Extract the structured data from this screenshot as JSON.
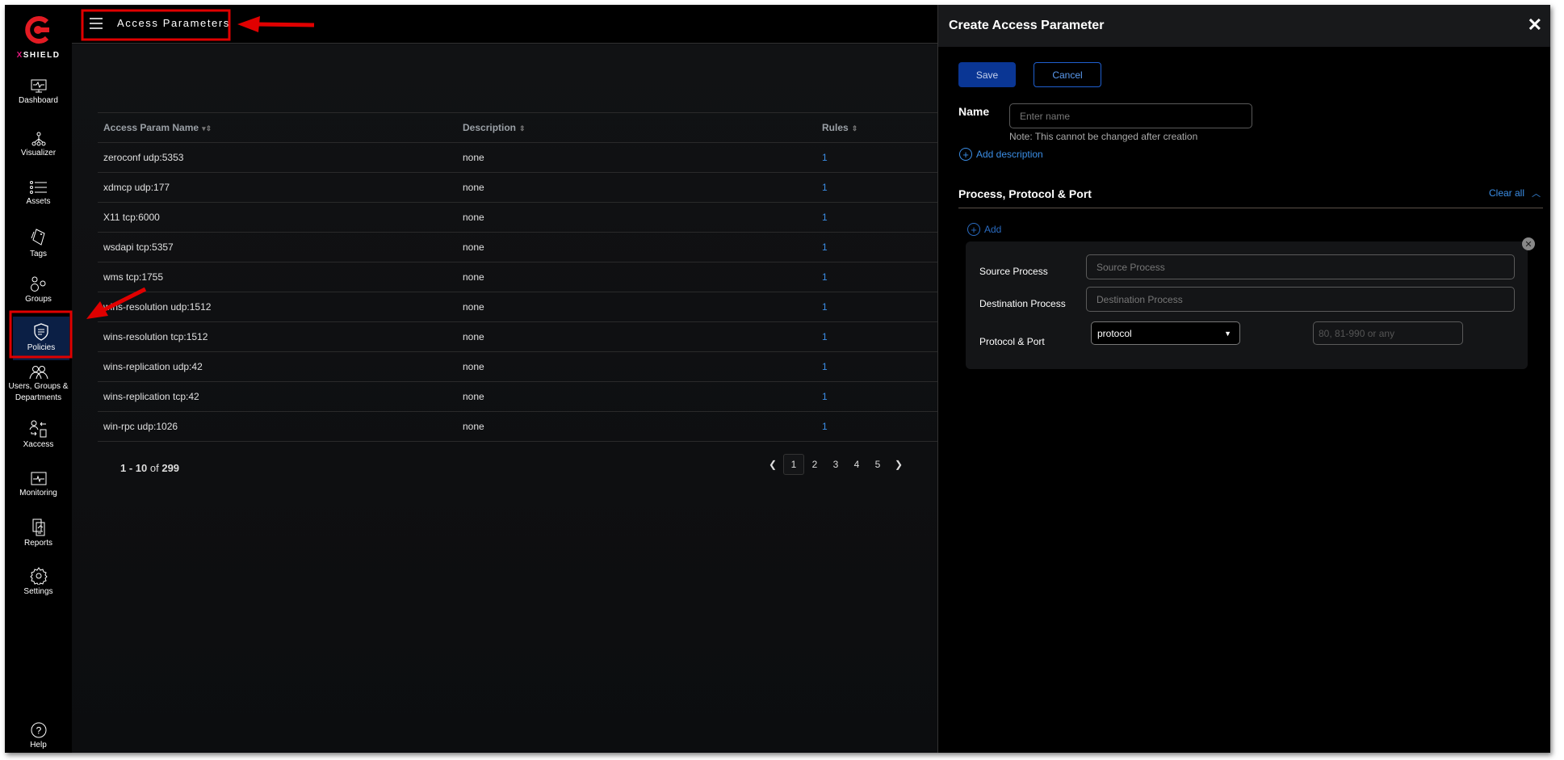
{
  "brand": {
    "prefix": "X",
    "rest": "SHIELD"
  },
  "sidebar": {
    "items": [
      {
        "label": "Dashboard",
        "icon": "dashboard-icon"
      },
      {
        "label": "Visualizer",
        "icon": "visualizer-icon"
      },
      {
        "label": "Assets",
        "icon": "assets-icon"
      },
      {
        "label": "Tags",
        "icon": "tags-icon"
      },
      {
        "label": "Groups",
        "icon": "groups-icon"
      },
      {
        "label": "Policies",
        "icon": "policies-icon",
        "active": true
      },
      {
        "label": "Users, Groups & Departments",
        "icon": "users-icon"
      },
      {
        "label": "Xaccess",
        "icon": "xaccess-icon"
      },
      {
        "label": "Monitoring",
        "icon": "monitoring-icon"
      },
      {
        "label": "Reports",
        "icon": "reports-icon"
      },
      {
        "label": "Settings",
        "icon": "settings-icon"
      },
      {
        "label": "Help",
        "icon": "help-icon"
      }
    ]
  },
  "header": {
    "title": "Access Parameters"
  },
  "table": {
    "columns": [
      "Access Param Name",
      "Description",
      "Rules"
    ],
    "rows": [
      [
        "zeroconf udp:5353",
        "none",
        "1"
      ],
      [
        "xdmcp udp:177",
        "none",
        "1"
      ],
      [
        "X11 tcp:6000",
        "none",
        "1"
      ],
      [
        "wsdapi tcp:5357",
        "none",
        "1"
      ],
      [
        "wms tcp:1755",
        "none",
        "1"
      ],
      [
        "wins-resolution udp:1512",
        "none",
        "1"
      ],
      [
        "wins-resolution tcp:1512",
        "none",
        "1"
      ],
      [
        "wins-replication udp:42",
        "none",
        "1"
      ],
      [
        "wins-replication tcp:42",
        "none",
        "1"
      ],
      [
        "win-rpc udp:1026",
        "none",
        "1"
      ]
    ]
  },
  "pagination": {
    "range": "1 - 10",
    "of": "of",
    "total": "299",
    "pages": [
      "1",
      "2",
      "3",
      "4",
      "5"
    ],
    "current": "1"
  },
  "panel": {
    "title": "Create Access Parameter",
    "save": "Save",
    "cancel": "Cancel",
    "name_label": "Name",
    "name_placeholder": "Enter name",
    "note": "Note: This cannot be changed after creation",
    "add_description": "Add description",
    "section_title": "Process, Protocol & Port",
    "clear_all": "Clear all",
    "add": "Add",
    "source_label": "Source Process",
    "source_placeholder": "Source Process",
    "dest_label": "Destination Process",
    "dest_placeholder": "Destination Process",
    "protocol_label": "Protocol & Port",
    "protocol_value": "protocol",
    "port_placeholder": "80, 81-990 or any"
  },
  "colors": {
    "accent": "#3b8ee6",
    "save": "#0a3694",
    "brand_red": "#e31b23",
    "annotation": "#e00000"
  }
}
